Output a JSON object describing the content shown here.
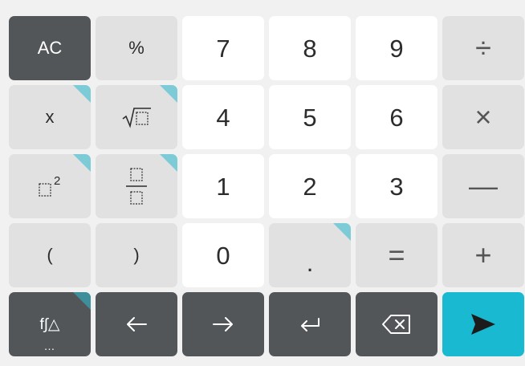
{
  "keys": {
    "ac": "AC",
    "percent": "%",
    "seven": "7",
    "eight": "8",
    "nine": "9",
    "divide": "÷",
    "x": "x",
    "four": "4",
    "five": "5",
    "six": "6",
    "multiply": "×",
    "one": "1",
    "two": "2",
    "three": "3",
    "minus": "—",
    "open_paren": "(",
    "close_paren": ")",
    "zero": "0",
    "decimal": ".",
    "equals": "=",
    "plus": "+",
    "functions": "f∫△",
    "functions_more": "…"
  },
  "icons": {
    "sqrt": "square-root-icon",
    "power": "squared-icon",
    "fraction": "fraction-icon",
    "left": "arrow-left-icon",
    "right": "arrow-right-icon",
    "enter": "enter-return-icon",
    "backspace": "backspace-icon",
    "send": "send-icon"
  },
  "colors": {
    "background": "#f1f1f1",
    "white_key": "#ffffff",
    "gray_key": "#e1e1e2",
    "dark_key": "#535658",
    "accent_key": "#18b9d1",
    "corner_marker": "#7ecbd8"
  }
}
